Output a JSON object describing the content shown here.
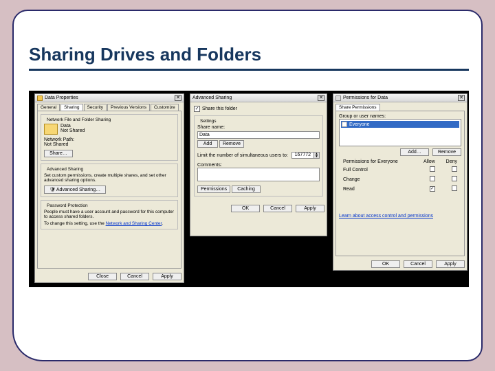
{
  "slide": {
    "title": "Sharing Drives and Folders"
  },
  "props": {
    "windowTitle": "Data Properties",
    "close": "✕",
    "tabs": {
      "general": "General",
      "sharing": "Sharing",
      "security": "Security",
      "previous": "Previous Versions",
      "customize": "Customize"
    },
    "nfs": {
      "group": "Network File and Folder Sharing",
      "name": "Data",
      "status": "Not Shared",
      "pathLabel": "Network Path:",
      "path": "Not Shared",
      "shareBtn": "Share…"
    },
    "adv": {
      "group": "Advanced Sharing",
      "desc": "Set custom permissions, create multiple shares, and set other advanced sharing options.",
      "btn": "Advanced Sharing…"
    },
    "pw": {
      "group": "Password Protection",
      "desc": "People must have a user account and password for this computer to access shared folders.",
      "change": "To change this setting, use the ",
      "link": "Network and Sharing Center"
    },
    "ok": "Close",
    "cancel": "Cancel",
    "apply": "Apply"
  },
  "advdlg": {
    "windowTitle": "Advanced Sharing",
    "close": "✕",
    "shareLabel": "Share this folder",
    "settings": "Settings",
    "shareNameLabel": "Share name:",
    "shareName": "Data",
    "add": "Add",
    "remove": "Remove",
    "limitLabel": "Limit the number of simultaneous users to:",
    "limitValue": "167772",
    "commentsLabel": "Comments:",
    "permissions": "Permissions",
    "caching": "Caching",
    "ok": "OK",
    "cancel": "Cancel",
    "apply": "Apply"
  },
  "permdlg": {
    "windowTitle": "Permissions for Data",
    "close": "✕",
    "tab": "Share Permissions",
    "groupLabel": "Group or user names:",
    "everyone": "Everyone",
    "add": "Add…",
    "remove": "Remove",
    "permForLabel": "Permissions for Everyone",
    "allow": "Allow",
    "deny": "Deny",
    "rows": {
      "full": "Full Control",
      "change": "Change",
      "read": "Read"
    },
    "learn": "Learn about access control and permissions",
    "ok": "OK",
    "cancel": "Cancel",
    "apply": "Apply"
  }
}
